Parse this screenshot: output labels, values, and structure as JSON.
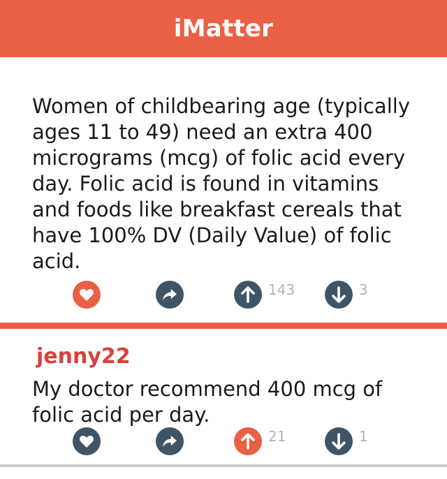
{
  "app": {
    "title": "iMatter"
  },
  "post": {
    "text": "Women of childbearing age (typically ages 11 to 49) need an extra 400 micrograms (mcg) of folic acid every day. Folic acid is found in vitamins and foods like breakfast cereals that have 100% DV (Daily Value) of folic acid.",
    "upvotes": "143",
    "downvotes": "3",
    "liked": true,
    "icons": [
      "heart-icon",
      "share-icon",
      "upvote-icon",
      "downvote-icon"
    ]
  },
  "comment": {
    "username": "jenny22",
    "text": "My doctor recommend 400 mcg of folic acid per day.",
    "upvotes": "21",
    "downvotes": "1",
    "upvoted": true
  },
  "colors": {
    "accent": "#ea6044",
    "icon_dark": "#3f5566",
    "username": "#d8413c"
  }
}
